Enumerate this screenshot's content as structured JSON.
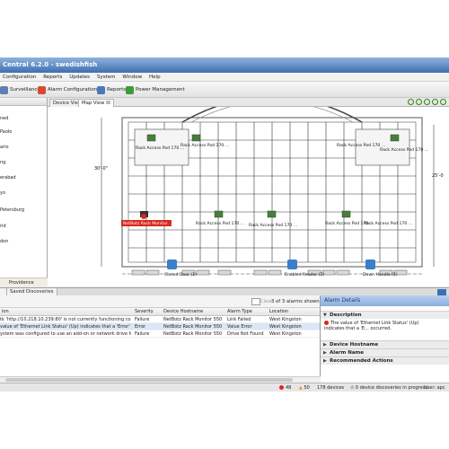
{
  "window": {
    "title": "Central 6.2.0 - swedishfish"
  },
  "menu": [
    "Configuration",
    "Reports",
    "Updates",
    "System",
    "Window",
    "Help"
  ],
  "toolbar": {
    "surveillance": "Surveillance",
    "alarm_configuration": "Alarm Configuration",
    "reports": "Reports",
    "power_management": "Power Management"
  },
  "sidebar": {
    "sites": [
      "ned",
      "Paolo",
      "ario",
      "ng",
      "erabad",
      "yo",
      "Petersburg",
      "rid",
      "don"
    ],
    "bottom_item": "Providence"
  },
  "tabs": {
    "device_view": "Device View",
    "map_view": "Map View",
    "map_view_close": "☒"
  },
  "map": {
    "dim_left": "30'-0\"",
    "dim_right": "25'-0",
    "pods": [
      "Rack Access Pod 170 ...",
      "Rack Access Pod 170 ...",
      "Rack Access Pod 170 ...",
      "Rack Access Pod 170 ...",
      "Rack Access Pod 170 ...",
      "Rack Access Pod 170 ...",
      "Rack Access Pod 170 ...",
      "Rack Access Pod 170 ..."
    ],
    "alarm_device": "NetBotz Rack Monitor ...",
    "sensors": [
      "Closed Door (1)",
      "Enabled Reader (2)",
      "Down Handle (2)"
    ]
  },
  "bottom_tabs": {
    "saved_discoveries": "Saved Discoveries"
  },
  "alarms": {
    "clear_label": "Clear",
    "shown": "3 of 3 alarms shown",
    "columns": [
      "ion",
      "Severity",
      "Device Hostname",
      "Alarm Type",
      "Location"
    ],
    "rows": [
      [
        "tk 'http://10.218.10.239:80' is not currently functioning corre...",
        "Failure",
        "NetBotz Rack Monitor 550",
        "Link Failed",
        "West Kingston"
      ],
      [
        "value of 'Ethernet Link Status' (Up) indicates that a 'Error' alert ...",
        "Error",
        "NetBotz Rack Monitor 550",
        "Value Error",
        "West Kingston"
      ],
      [
        "ystem was configured to use an add-on or network drive for s...",
        "Failure",
        "NetBotz Rack Monitor 550",
        "Drive Not Found",
        "West Kingston"
      ]
    ]
  },
  "details": {
    "title": "Alarm Details",
    "description_header": "Description",
    "description_text": "The value of 'Ethernet Link Status' (Up) indicates that a 'E... occurred.",
    "sections": [
      "Device Hostname",
      "Alarm Name",
      "Recommended Actions"
    ]
  },
  "status": {
    "errors": "48",
    "warnings": "50",
    "devices": "178 devices",
    "discoveries": "0 device discoveries in progress.",
    "user": "User: apc"
  },
  "colors": {
    "title_gradient_top": "#8fb3dc",
    "title_gradient_bottom": "#3f6fb0",
    "alarm_red": "#d7281c",
    "details_header": "#9bbbe6",
    "pod_icon": "#4a7c3d"
  }
}
